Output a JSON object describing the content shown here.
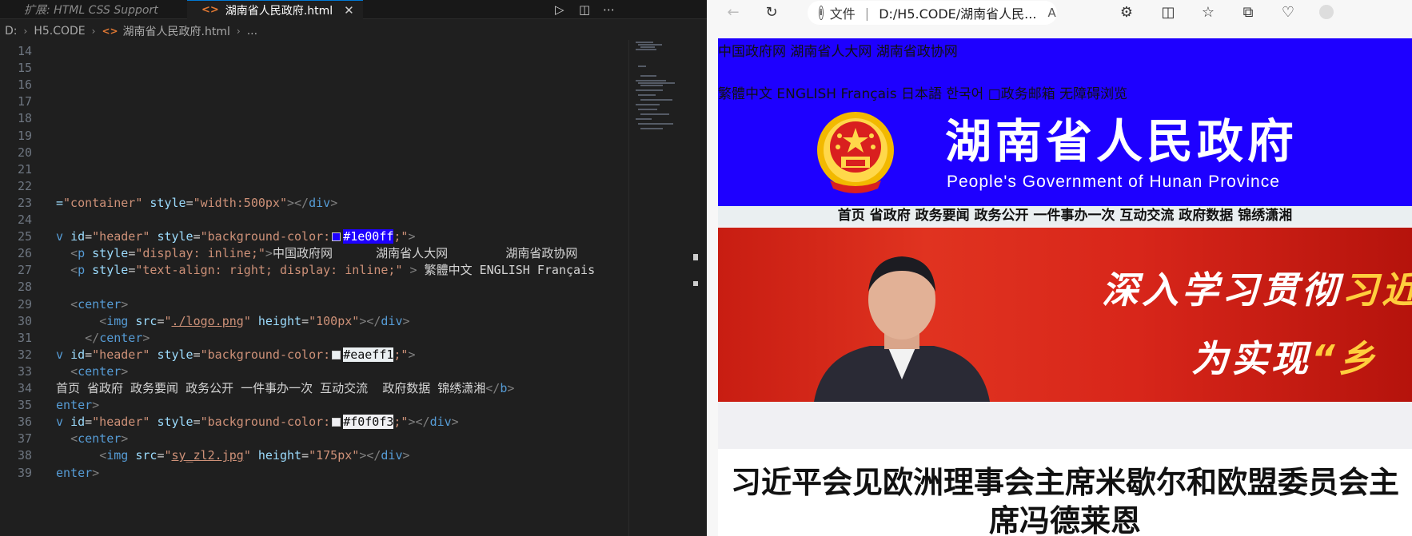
{
  "editor": {
    "tabs": {
      "extension_tab": "扩展: HTML CSS Support",
      "active_tab": "湖南省人民政府.html",
      "close_glyph": "✕"
    },
    "breadcrumb": {
      "drive": "D:",
      "folder": "H5.CODE",
      "file": "湖南省人民政府.html",
      "more": "..."
    },
    "lines": [
      {
        "n": "14",
        "html": ""
      },
      {
        "n": "15",
        "html": ""
      },
      {
        "n": "16",
        "html": ""
      },
      {
        "n": "17",
        "html": ""
      },
      {
        "n": "18",
        "html": ""
      },
      {
        "n": "19",
        "html": ""
      },
      {
        "n": "20",
        "html": ""
      },
      {
        "n": "21",
        "html": ""
      },
      {
        "n": "22",
        "html": ""
      },
      {
        "n": "23",
        "html": "<span class=\"t-attr\">=</span><span class=\"t-str\">\"container\"</span> <span class=\"t-attr\">style</span>=<span class=\"t-str\">\"width:500px\"</span><span class=\"t-punct\">&gt;&lt;/</span><span class=\"t-tag\">div</span><span class=\"t-punct\">&gt;</span>"
      },
      {
        "n": "24",
        "html": ""
      },
      {
        "n": "25",
        "html": "<span class=\"t-tag\">v</span> <span class=\"t-attr\">id</span>=<span class=\"t-str\">\"header\"</span> <span class=\"t-attr\">style</span>=<span class=\"t-str\">\"background-color:<span class=\"swatch\" style=\"background:#1e00ff\"></span><span class=\"hl-blue\">#1e00ff</span>;\"</span><span class=\"t-punct\">&gt;</span>"
      },
      {
        "n": "26",
        "html": "  <span class=\"t-punct\">&lt;</span><span class=\"t-tag\">p</span> <span class=\"t-attr\">style</span>=<span class=\"t-str\">\"display: inline;\"</span><span class=\"t-punct\">&gt;</span><span class=\"t-text\">中国政府网      湖南省人大网        湖南省政协网</span>"
      },
      {
        "n": "27",
        "html": "  <span class=\"t-punct\">&lt;</span><span class=\"t-tag\">p</span> <span class=\"t-attr\">style</span>=<span class=\"t-str\">\"text-align: right; display: inline;\"</span> <span class=\"t-punct\">&gt;</span> <span class=\"t-text\">繁體中文 ENGLISH Français</span>"
      },
      {
        "n": "28",
        "html": ""
      },
      {
        "n": "29",
        "html": "  <span class=\"t-punct\">&lt;</span><span class=\"t-tag\">center</span><span class=\"t-punct\">&gt;</span>"
      },
      {
        "n": "30",
        "html": "      <span class=\"t-punct\">&lt;</span><span class=\"t-tag\">img</span> <span class=\"t-attr\">src</span>=<span class=\"t-str\">\"<span class=\"t-link\">./logo.png</span>\"</span> <span class=\"t-attr\">height</span>=<span class=\"t-str\">\"100px\"</span><span class=\"t-punct\">&gt;&lt;/</span><span class=\"t-tag\">div</span><span class=\"t-punct\">&gt;</span>"
      },
      {
        "n": "31",
        "html": "    <span class=\"t-punct\">&lt;/</span><span class=\"t-tag\">center</span><span class=\"t-punct\">&gt;</span>"
      },
      {
        "n": "32",
        "html": "<span class=\"t-tag\">v</span> <span class=\"t-attr\">id</span>=<span class=\"t-str\">\"header\"</span> <span class=\"t-attr\">style</span>=<span class=\"t-str\">\"background-color:<span class=\"swatch\" style=\"background:#eaeff1\"></span><span class=\"hl-light\">#eaeff1</span>;\"</span><span class=\"t-punct\">&gt;</span>"
      },
      {
        "n": "33",
        "html": "  <span class=\"t-punct\">&lt;</span><span class=\"t-tag\">center</span><span class=\"t-punct\">&gt;</span>"
      },
      {
        "n": "34",
        "html": "<span class=\"t-text\">首页 省政府 政务要闻 政务公开 一件事办一次 互动交流  政府数据 锦绣潇湘</span><span class=\"t-punct\">&lt;/</span><span class=\"t-tag\">b</span><span class=\"t-punct\">&gt;</span>"
      },
      {
        "n": "35",
        "html": "<span class=\"t-tag\">enter</span><span class=\"t-punct\">&gt;</span>"
      },
      {
        "n": "36",
        "html": "<span class=\"t-tag\">v</span> <span class=\"t-attr\">id</span>=<span class=\"t-str\">\"header\"</span> <span class=\"t-attr\">style</span>=<span class=\"t-str\">\"background-color:<span class=\"swatch\" style=\"background:#f0f0f3\"></span><span class=\"hl-light2\">#f0f0f3</span>;\"</span><span class=\"t-punct\">&gt;&lt;/</span><span class=\"t-tag\">div</span><span class=\"t-punct\">&gt;</span>"
      },
      {
        "n": "37",
        "html": "  <span class=\"t-punct\">&lt;</span><span class=\"t-tag\">center</span><span class=\"t-punct\">&gt;</span>"
      },
      {
        "n": "38",
        "html": "      <span class=\"t-punct\">&lt;</span><span class=\"t-tag\">img</span> <span class=\"t-attr\">src</span>=<span class=\"t-str\">\"<span class=\"t-link\">sy_zl2.jpg</span>\"</span> <span class=\"t-attr\">height</span>=<span class=\"t-str\">\"175px\"</span><span class=\"t-punct\">&gt;&lt;/</span><span class=\"t-tag\">div</span><span class=\"t-punct\">&gt;</span>"
      },
      {
        "n": "39",
        "html": "<span class=\"t-tag\">enter</span><span class=\"t-punct\">&gt;</span>"
      }
    ]
  },
  "browser": {
    "address": {
      "file_label": "文件",
      "divider": "|",
      "url": "D:/H5.CODE/湖南省人民..."
    },
    "page": {
      "top_links": "中国政府网 湖南省人大网 湖南省政协网",
      "lang_links": "繁體中文 ENGLISH Français 日本語 한국어 □政务邮箱 无障碍浏览",
      "logo_title": "湖南省人民政府",
      "logo_subtitle": "People's Government of Hunan Province",
      "nav": "首页 省政府 政务要闻 政务公开 一件事办一次 互动交流 政府数据 锦绣潇湘",
      "banner_line1_white": "深入学习贯彻",
      "banner_line1_gold": "习近",
      "banner_line2_white": "为实现",
      "banner_line2_gold": "“乡",
      "article_title": "习近平会见欧洲理事会主席米歇尔和欧盟委员会主席冯德莱恩"
    },
    "colors": {
      "header_bg": "#1e00ff",
      "nav_bg": "#eaeff1",
      "banner_bg": "#f0f0f3"
    }
  }
}
